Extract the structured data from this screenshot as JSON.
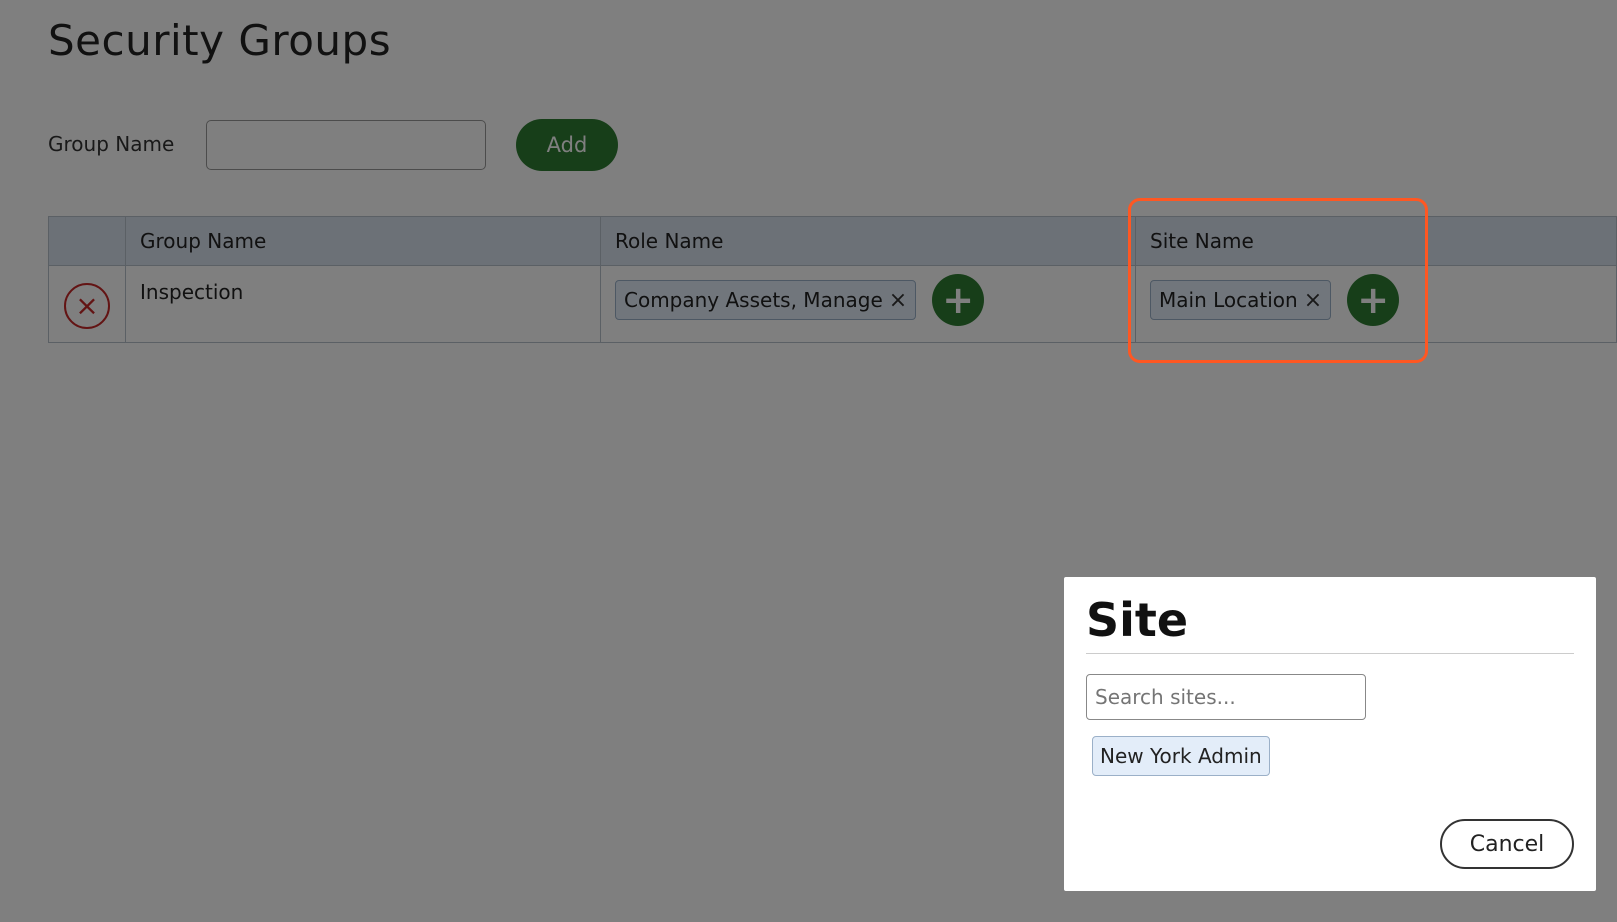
{
  "page": {
    "title": "Security Groups"
  },
  "group_form": {
    "label": "Group Name",
    "input_value": "",
    "add_label": "Add"
  },
  "table": {
    "headers": [
      "",
      "Group Name",
      "Role Name",
      "Site Name"
    ],
    "rows": [
      {
        "delete_icon": "×",
        "group_name": "Inspection",
        "role_chip": "Company Assets, Manage",
        "role_chip_remove": "×",
        "site_chip": "Main Location",
        "site_chip_remove": "×",
        "add_icon": "+"
      }
    ]
  },
  "dialog": {
    "title": "Site",
    "search_placeholder": "Search sites...",
    "options": [
      "New York Admin"
    ],
    "cancel_label": "Cancel"
  },
  "colors": {
    "accent_green": "#2e7d32",
    "delete_red": "#c62828",
    "highlight_orange": "#ff5722",
    "chip_bg": "#e3edf9"
  },
  "icons": {
    "delete": "close-circle-icon",
    "add": "plus-circle-icon",
    "chip_remove": "close-icon"
  }
}
